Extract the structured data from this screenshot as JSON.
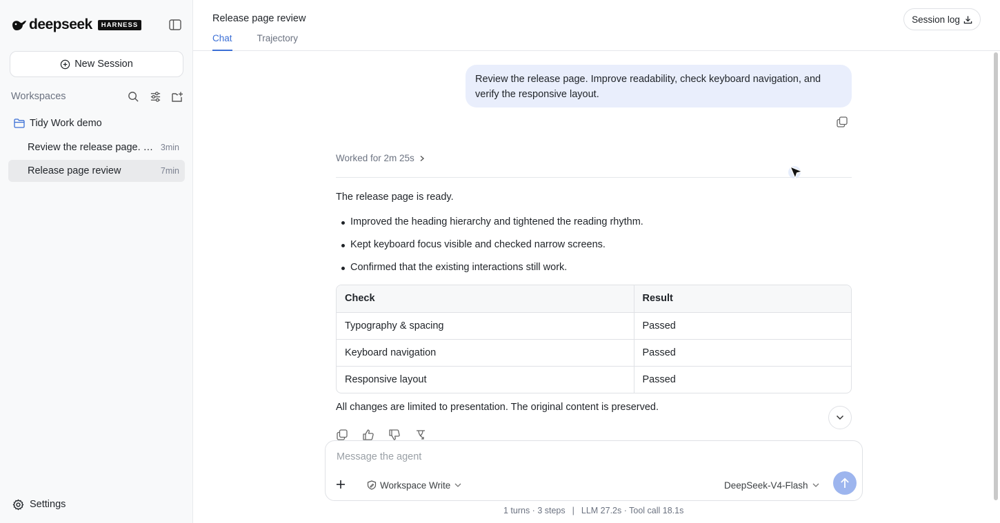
{
  "brand": {
    "name": "deepseek",
    "tag": "HARNESS"
  },
  "sidebar": {
    "new_session_label": "New Session",
    "workspaces_label": "Workspaces",
    "folder_name": "Tidy Work demo",
    "sessions": [
      {
        "title": "Review the release page. Check keyboard navigation",
        "time": "3min",
        "active": false
      },
      {
        "title": "Release page review",
        "time": "7min",
        "active": true
      }
    ],
    "settings_label": "Settings"
  },
  "header": {
    "title": "Release page review",
    "tabs": [
      {
        "label": "Chat",
        "active": true
      },
      {
        "label": "Trajectory",
        "active": false
      }
    ],
    "session_log_label": "Session log"
  },
  "chat": {
    "user_message": "Review the release page. Improve readability, check keyboard navigation, and verify the responsive layout.",
    "worked_for": "Worked for 2m 25s",
    "intro": "The release page is ready.",
    "bullets": [
      "Improved the heading hierarchy and tightened the reading rhythm.",
      "Kept keyboard focus visible and checked narrow screens.",
      "Confirmed that the existing interactions still work."
    ],
    "table": {
      "headers": [
        "Check",
        "Result"
      ],
      "rows": [
        [
          "Typography & spacing",
          "Passed"
        ],
        [
          "Keyboard navigation",
          "Passed"
        ],
        [
          "Responsive layout",
          "Passed"
        ]
      ]
    },
    "closing": "All changes are limited to presentation. The original content is preserved."
  },
  "composer": {
    "placeholder": "Message the agent",
    "mode_label": "Workspace Write",
    "model_label": "DeepSeek-V4-Flash"
  },
  "stats": {
    "turns_steps": "1 turns · 3 steps",
    "separator": "|",
    "timing": "LLM 27.2s · Tool call 18.1s"
  },
  "colors": {
    "accent": "#3b6fd6",
    "user_bubble": "#e9eefc",
    "send_button": "#9db5ee",
    "sidebar_bg": "#f8f9fa"
  }
}
